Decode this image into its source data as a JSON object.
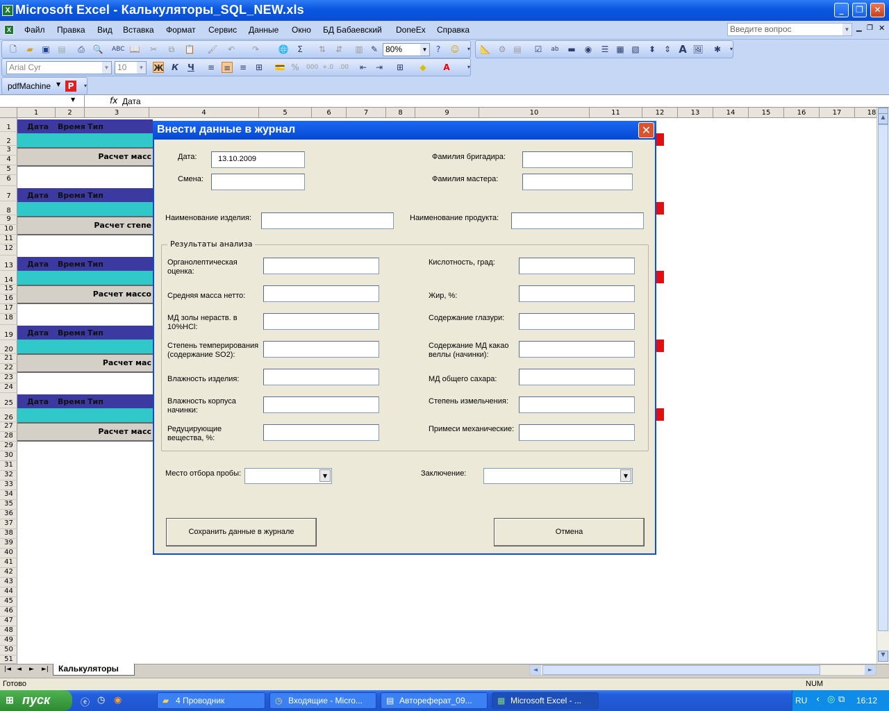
{
  "window": {
    "title": "Microsoft Excel - Калькуляторы_SQL_NEW.xls",
    "icon": "excel-icon"
  },
  "menu": {
    "items": [
      "Файл",
      "Правка",
      "Вид",
      "Вставка",
      "Формат",
      "Сервис",
      "Данные",
      "Окно",
      "БД Бабаевский",
      "DoneEx",
      "Справка"
    ],
    "help_placeholder": "Введите вопрос"
  },
  "toolbar": {
    "zoom": "80%",
    "font_name": "Arial Cyr",
    "font_size": "10",
    "pdf_label": "pdfMachine"
  },
  "formula": {
    "fx": "fx",
    "value": "Дата"
  },
  "columns": [
    "1",
    "2",
    "3",
    "4",
    "5",
    "6",
    "7",
    "8",
    "9",
    "10",
    "11",
    "12",
    "13",
    "14",
    "15",
    "16",
    "17",
    "18"
  ],
  "rows": [
    "1",
    "2",
    "3",
    "4",
    "5",
    "6",
    "7",
    "8",
    "9",
    "10",
    "11",
    "12",
    "13",
    "14",
    "15",
    "16",
    "17",
    "18",
    "19",
    "20",
    "21",
    "22",
    "23",
    "24",
    "25",
    "26",
    "27",
    "28",
    "29",
    "30",
    "31",
    "32",
    "33",
    "34",
    "35",
    "36",
    "37",
    "38",
    "39",
    "40",
    "41",
    "42",
    "43",
    "44",
    "45",
    "46",
    "47",
    "48",
    "49",
    "50",
    "51"
  ],
  "sheet": {
    "header_cells": [
      "Дата",
      "Время",
      "Тип продукции"
    ],
    "calc_rows": [
      "Расчет масс",
      "Расчет степе",
      "Расчет массо",
      "Расчет мас",
      "Расчет масс"
    ],
    "tab": "Калькуляторы"
  },
  "status": {
    "left": "Готово",
    "num": "NUM"
  },
  "dialog": {
    "title": "Внести данные в журнал",
    "date_label": "Дата:",
    "date_value": "13.10.2009",
    "shift_label": "Смена:",
    "brigadier_label": "Фамилия бригадира:",
    "master_label": "Фамилия мастера:",
    "item_name_label": "Наименование изделия:",
    "product_name_label": "Наименование продукта:",
    "group_title": "Результаты анализа",
    "left_fields": [
      "Органолептическая\nоценка:",
      "Средняя масса нетто:",
      "МД  золы нераств. в\n10%HCl:",
      "Степень темперирования\n(содержание SO2):",
      "Влажность изделия:",
      "Влажность корпуса\nначинки:",
      "Редуцирующие\nвещества, %:"
    ],
    "right_fields": [
      "Кислотность,  град:",
      "Жир, %:",
      "Содержание глазури:",
      "Содержание МД какао\nвеллы (начинки):",
      "МД общего сахара:",
      "Степень измельчения:",
      "Примеси механические:"
    ],
    "sample_place_label": "Место отбора пробы:",
    "conclusion_label": "Заключение:",
    "save_button": "Сохранить данные в журнале",
    "cancel_button": "Отмена"
  },
  "taskbar": {
    "start": "пуск",
    "tasks": [
      "4 Проводник",
      "Входящие - Micro...",
      "Автореферат_09...",
      "Microsoft Excel - ..."
    ],
    "lang": "RU",
    "time": "16:12"
  },
  "colors": {
    "header_blue": "#3c39a0",
    "teal": "#30c8c8",
    "red_marker": "#e01010",
    "xp_blue": "#0a4fd4"
  }
}
